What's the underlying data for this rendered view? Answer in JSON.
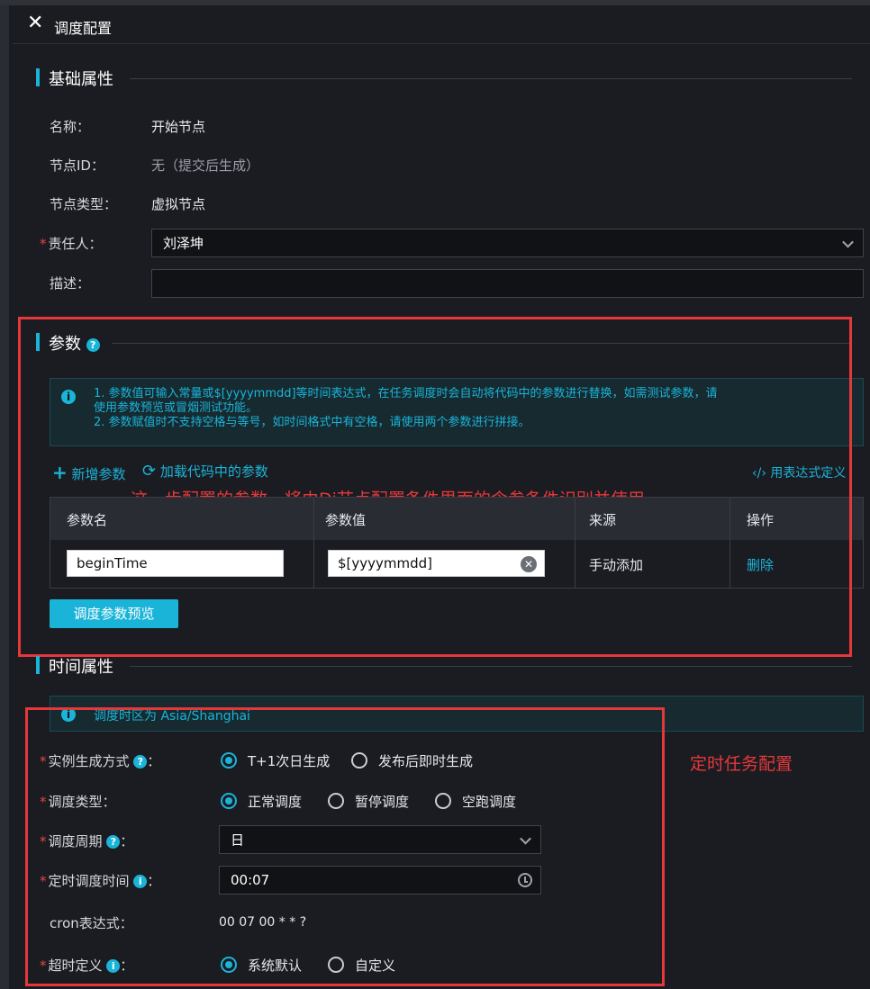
{
  "header": {
    "close_icon": "✕",
    "title": "调度配置"
  },
  "basic": {
    "section_title": "基础属性",
    "name_label": "名称：",
    "name_value": "开始节点",
    "id_label": "节点ID：",
    "id_value": "无（提交后生成）",
    "type_label": "节点类型：",
    "type_value": "虚拟节点",
    "owner_label": "责任人：",
    "owner_value": "刘泽坤",
    "desc_label": "描述："
  },
  "params": {
    "section_title": "参数",
    "info_line1": "1. 参数值可输入常量或$[yyyymmdd]等时间表达式，在任务调度时会自动将代码中的参数进行替换，如需测试参数，请",
    "info_line2": "使用参数预览或冒烟测试功能。",
    "info_line3": "2. 参数赋值时不支持空格与等号，如时间格式中有空格，请使用两个参数进行拼接。",
    "add_label": "新增参数",
    "load_label": "加载代码中的参数",
    "expr_label": "用表达式定义",
    "columns": [
      "参数名",
      "参数值",
      "来源",
      "操作"
    ],
    "rows": [
      {
        "name": "beginTime",
        "value": "$[yyyymmdd]",
        "source": "手动添加",
        "action": "删除"
      }
    ],
    "preview_button": "调度参数预览",
    "annotation": "这一步配置的参数，将由Di节点配置条件里面的含参条件识别并使用"
  },
  "time": {
    "section_title": "时间属性",
    "timezone_info": "调度时区为 Asia/Shanghai",
    "instance_label": "实例生成方式",
    "instance_options": [
      "T+1次日生成",
      "发布后即时生成"
    ],
    "schedule_type_label": "调度类型：",
    "schedule_type_options": [
      "正常调度",
      "暂停调度",
      "空跑调度"
    ],
    "cycle_label": "调度周期",
    "cycle_value": "日",
    "time_label": "定时调度时间",
    "time_value": "00:07",
    "cron_label": "cron表达式：",
    "cron_value": "00 07 00 * * ?",
    "timeout_label": "超时定义",
    "timeout_options": [
      "系统默认",
      "自定义"
    ],
    "annotation": "定时任务配置"
  },
  "colors": {
    "accent": "#1ab4d8",
    "annotation_red": "#e5383b",
    "background": "#1b1c21"
  }
}
